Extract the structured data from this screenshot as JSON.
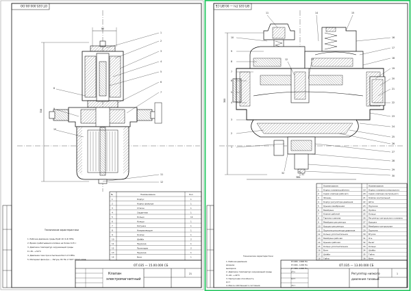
{
  "sheet_left": {
    "corner_code": "ОТ.035.000.00.ОО",
    "dims": {
      "d_top": "80",
      "h_total": "316"
    },
    "callouts": [
      "1",
      "2",
      "3",
      "4",
      "5",
      "6",
      "7",
      "8",
      "9",
      "10",
      "11",
      "12"
    ],
    "tech_req_title": "Технические характеристики",
    "tech_req": [
      "1. Рабочее давление среды Рраб 16 (1,6) МПа",
      "2. Время срабатывания клапана не более 0,15 с",
      "3. Диапазон температур окружающей среды",
      "   t=-30...+50°С",
      "4. Давление газа при испытании Рисп 2,5 МПа",
      "5. Материал фильтра — Латунь ЛС 59-1 ГОСТ 15527-2004"
    ],
    "spec_headers": [
      "№",
      "Наименование",
      "Кол"
    ],
    "spec_rows": [
      [
        "1",
        "Корпус",
        "1"
      ],
      [
        "2",
        "Корпус фильтра",
        "1"
      ],
      [
        "3",
        "Стакан",
        "1"
      ],
      [
        "4",
        "Сердечник",
        "1"
      ],
      [
        "5",
        "Кольцо",
        "14"
      ],
      [
        "6",
        "Кольцо",
        "1"
      ],
      [
        "7",
        "Катушка",
        "1"
      ],
      [
        "8",
        "Направляющая",
        "1"
      ],
      [
        "9",
        "Колпак",
        "1"
      ],
      [
        "10",
        "Шайба",
        "2"
      ],
      [
        "11",
        "Пружина",
        "1"
      ],
      [
        "12",
        "Прокладка",
        "2"
      ],
      [
        "13",
        "Пружина",
        "1"
      ],
      [
        "14",
        "Винт",
        "1"
      ]
    ],
    "title_code": "ОТ.035 — 15.00.000 СБ",
    "title_name_1": "Клапан",
    "title_name_2": "электромагнитный",
    "sheet_no": "21"
  },
  "sheet_right": {
    "corner_code": "ВП.035.ПЧ — 00.ВП.СБ",
    "dims": {
      "h_total": "380",
      "w_bottom": "380"
    },
    "callouts_top": [
      "11",
      "14",
      "15"
    ],
    "callouts_left": [
      "10",
      "9",
      "8",
      "7",
      "6",
      "5",
      "4",
      "3",
      "2",
      "1"
    ],
    "callouts_right": [
      "16",
      "17",
      "18",
      "19",
      "20",
      "21",
      "22",
      "23",
      "24",
      "25",
      "26",
      "27",
      "28",
      "29",
      "30"
    ],
    "callouts_bottom": [
      "32",
      "31"
    ],
    "callouts_mid": [
      "12",
      "13"
    ],
    "tech_title": "Технические характеристики",
    "tech_lines": [
      "1. Рабочая давление",
      "   входное",
      "   выходное",
      "2. Диапазон температур окружающей среды",
      "   t=-40...+40°С",
      "3. Пропускная способность",
      "   Q=?",
      "4. Масса собственного состояния"
    ],
    "tech_values": [
      "Р=400...1600 Па",
      "Р=400...1200 Па",
      "Р=400...1000 Па",
      "м³/ч",
      "Q=?",
      "70 т"
    ],
    "spec_col_left": [
      "Наименование",
      "Корпус клапана рабочего",
      "Седло клапана рабочего",
      "Фланец",
      "Корпус регулятора давления",
      "Крышка мембранная",
      "Мембрана",
      "Клапан рабочий",
      "Тарелка клапана",
      "Мембрана регулятора",
      "Крышка регулятора",
      "Пружина регулятора давления",
      "Кольцо уплотнительное",
      "Мембрана рабочая",
      "Крышка рабочая",
      "Кольцо уплотнительное",
      "Винт",
      "Шайба",
      "Гайка"
    ],
    "spec_col_right": [
      "Наименование",
      "Корпус клапана контрольного",
      "Седло клапана контрольного",
      "Клапан контрольный",
      "Шток",
      "Пружина",
      "Пробка",
      "Кольцо",
      "Регулятор контрольного клапана",
      "Крышка",
      "Мембрана контрольная",
      "Пружина",
      "Втулка",
      "Ось",
      "Рычаг",
      "Кольцо",
      "Шайба",
      "Гайка",
      "Винт"
    ],
    "title_code": "ОТ.035 — 13.00.000 СБ",
    "title_name_1": "Регулятор низкого",
    "title_name_2": "давления газовый",
    "sheet_no": "1"
  },
  "colors": {
    "frame_active": "#22c55e",
    "line": "#111111",
    "hatch": "#444444"
  }
}
